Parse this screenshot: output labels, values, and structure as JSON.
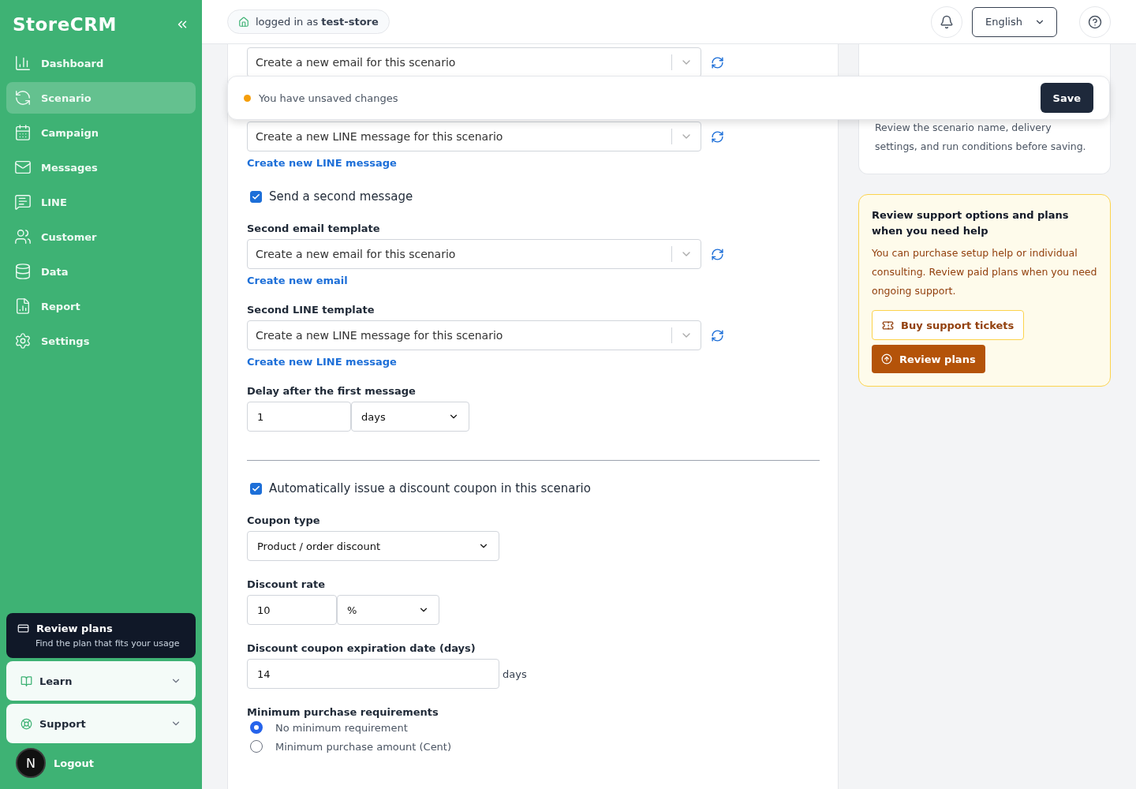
{
  "sidebar": {
    "brand": "StoreCRM",
    "items": [
      {
        "label": "Dashboard",
        "selected": false
      },
      {
        "label": "Scenario",
        "selected": true
      },
      {
        "label": "Campaign",
        "selected": false
      },
      {
        "label": "Messages",
        "selected": false
      },
      {
        "label": "LINE",
        "selected": false
      },
      {
        "label": "Customer",
        "selected": false
      },
      {
        "label": "Data",
        "selected": false
      },
      {
        "label": "Report",
        "selected": false
      },
      {
        "label": "Settings",
        "selected": false
      }
    ],
    "promo": {
      "title": "Review plans",
      "subtitle": "Find the plan that fits your usage"
    },
    "sections": [
      {
        "label": "Learn",
        "expanded": false
      },
      {
        "label": "Support",
        "expanded": false
      }
    ],
    "avatar": "N",
    "logout": "Logout"
  },
  "topbar": {
    "login": "logged in as **test-store**",
    "language": "English"
  },
  "unsaved": {
    "message": "You have unsaved changes",
    "save": "Save"
  },
  "form": {
    "first_email_select": "Create a new email for this scenario",
    "first_line_select": "Create a new LINE message for this scenario",
    "first_line_link": "Create new LINE message",
    "second_message": {
      "label": "Send a second message",
      "checked": true
    },
    "second_email": {
      "label": "Second email template",
      "value": "Create a new email for this scenario",
      "link": "Create new email"
    },
    "second_line": {
      "label": "Second LINE template",
      "value": "Create a new LINE message for this scenario",
      "link": "Create new LINE message"
    },
    "delay": {
      "label": "Delay after the first message",
      "value": "1",
      "unit": "days"
    },
    "coupon": {
      "label": "Automatically issue a discount coupon in this scenario",
      "checked": true
    },
    "coupon_type": {
      "label": "Coupon type",
      "value": "Product / order discount"
    },
    "discount_rate": {
      "label": "Discount rate",
      "value": "10",
      "unit": "%"
    },
    "expiration": {
      "label": "Discount coupon expiration date (days)",
      "value": "14",
      "suffix": "days"
    },
    "minimum": {
      "label": "Minimum purchase requirements",
      "options": [
        {
          "label": "No minimum requirement",
          "selected": true
        },
        {
          "label": "Minimum purchase amount (Cent)",
          "selected": false
        }
      ]
    }
  },
  "side": {
    "intro": "Review the scenario name, delivery settings, and run conditions before saving.",
    "support": {
      "title": "Review support options and plans when you need help",
      "body": "You can purchase setup help or individual consulting. Review paid plans when you need ongoing support.",
      "tickets": "Buy support tickets",
      "plans": "Review plans"
    }
  }
}
